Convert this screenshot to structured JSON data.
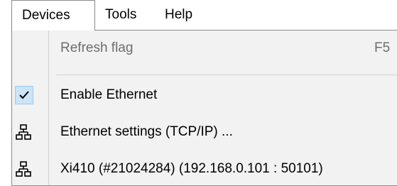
{
  "menubar": {
    "devices": "Devices",
    "tools": "Tools",
    "help": "Help"
  },
  "dropdown": {
    "refresh_flag": {
      "label": "Refresh flag",
      "shortcut": "F5",
      "enabled": false
    },
    "enable_ethernet": {
      "label": "Enable Ethernet",
      "checked": true
    },
    "ethernet_settings": {
      "label": "Ethernet settings (TCP/IP) ...",
      "icon": "network-icon"
    },
    "device": {
      "label": "Xi410  (#21024284)  (192.168.0.101 : 50101)",
      "icon": "network-icon"
    }
  },
  "colors": {
    "dropdown_bg": "#f2f2f2",
    "disabled_text": "#6d6d6d",
    "check_highlight": "#cce4f7",
    "border": "#8a8a8a"
  }
}
